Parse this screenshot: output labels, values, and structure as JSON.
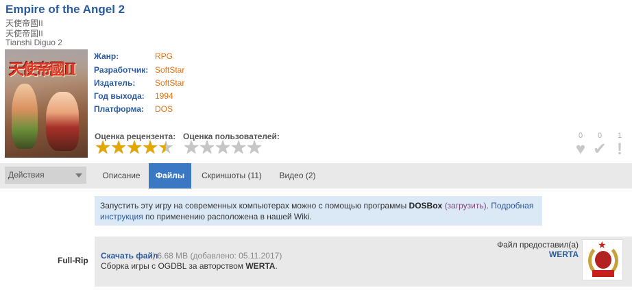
{
  "game": {
    "title": "Empire of the Angel 2",
    "alt_titles": [
      "天使帝國II",
      "天使帝国II",
      "Tianshi Diguo 2"
    ],
    "cover_logo": "天使帝國II"
  },
  "info": [
    {
      "label": "Жанр:",
      "value": "RPG"
    },
    {
      "label": "Разработчик:",
      "value": "SoftStar"
    },
    {
      "label": "Издатель:",
      "value": "SoftStar"
    },
    {
      "label": "Год выхода:",
      "value": "1994"
    },
    {
      "label": "Платформа:",
      "value": "DOS"
    }
  ],
  "ratings": {
    "reviewer_label": "Оценка рецензента:",
    "reviewer_stars": 4.5,
    "user_label": "Оценка пользователей:",
    "user_stars": 0,
    "max_stars": 5
  },
  "votes": [
    {
      "count": "0",
      "icon": "heart-icon"
    },
    {
      "count": "0",
      "icon": "checkmark-icon"
    },
    {
      "count": "1",
      "icon": "exclamation-icon"
    }
  ],
  "tabs": {
    "actions_label": "Действия",
    "items": [
      {
        "label": "Описание",
        "active": false
      },
      {
        "label": "Файлы",
        "active": true
      },
      {
        "label": "Скриншоты (11)",
        "active": false
      },
      {
        "label": "Видео (2)",
        "active": false
      }
    ]
  },
  "notice": {
    "text1": "Запустить эту игру на современных компьютерах можно с помощью программы ",
    "program": "DOSBox",
    "download_link": "(загрузить)",
    "text2": ". ",
    "guide_link": "Подробная инструкция",
    "text3": " по применению расположена в нашей Wiki."
  },
  "file": {
    "type": "Full-Rip",
    "download_label": "Скачать файл",
    "meta": "| 6.68 MB (добавлено: 05.11.2017)",
    "desc_prefix": "Сборка игры с OGDBL за авторством ",
    "desc_author": "WERTA",
    "desc_suffix": ".",
    "provided_label": "Файл предоставил(а)",
    "provided_by": "WERTA"
  },
  "colors": {
    "accent": "#2a5a9e",
    "value": "#e8700c",
    "tab_active": "#3b78c4",
    "star": "#e3a800"
  }
}
